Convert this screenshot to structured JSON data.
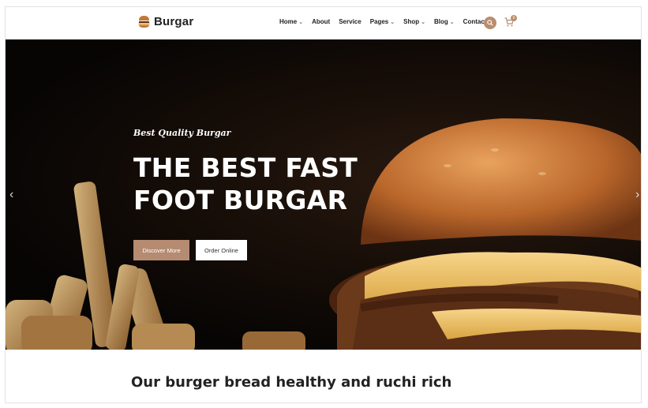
{
  "header": {
    "logo_text": "Burgar",
    "nav": [
      {
        "label": "Home",
        "dropdown": true
      },
      {
        "label": "About",
        "dropdown": false
      },
      {
        "label": "Service",
        "dropdown": false
      },
      {
        "label": "Pages",
        "dropdown": true
      },
      {
        "label": "Shop",
        "dropdown": true
      },
      {
        "label": "Blog",
        "dropdown": true
      },
      {
        "label": "Contact",
        "dropdown": false
      }
    ],
    "cart_count": "0"
  },
  "hero": {
    "subtitle": "Best Quality Burgar",
    "title_line1": "THE BEST FAST",
    "title_line2": "FOOT BURGAR",
    "primary_button": "Discover More",
    "secondary_button": "Order Online",
    "prev_arrow": "‹",
    "next_arrow": "›"
  },
  "section": {
    "title": "Our burger bread healthy and ruchi rich"
  },
  "colors": {
    "accent": "#b58b71",
    "dark_bg": "#0a0705",
    "text_dark": "#222222"
  },
  "icons": {
    "logo": "burger-icon",
    "search": "search-icon",
    "cart": "cart-icon",
    "prev": "chevron-left-icon",
    "next": "chevron-right-icon"
  }
}
